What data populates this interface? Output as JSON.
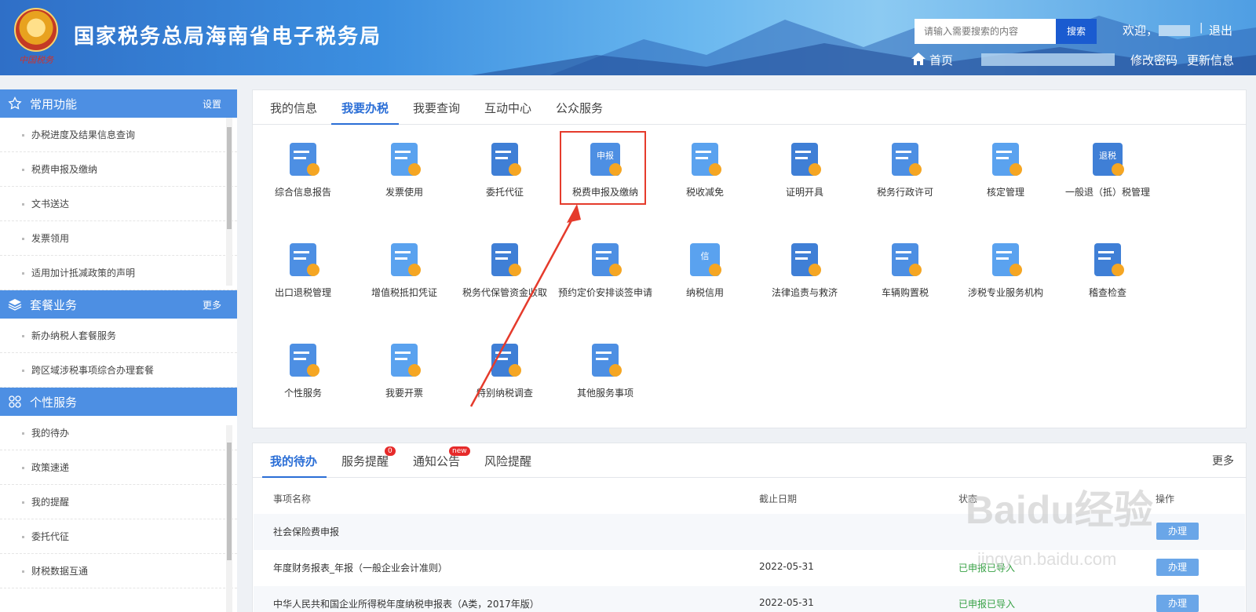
{
  "header": {
    "site_title": "国家税务总局海南省电子税务局",
    "emblem_text": "中国税务",
    "search_placeholder": "请输入需要搜索的内容",
    "search_label": "搜索",
    "welcome": "欢迎，",
    "logout": "退出",
    "home": "首页",
    "change_password": "修改密码",
    "update_info": "更新信息"
  },
  "sidebar": {
    "sections": [
      {
        "title": "常用功能",
        "action": "设置",
        "items": [
          "办税进度及结果信息查询",
          "税费申报及缴纳",
          "文书送达",
          "发票领用",
          "适用加计抵减政策的声明"
        ]
      },
      {
        "title": "套餐业务",
        "action": "更多",
        "items": [
          "新办纳税人套餐服务",
          "跨区域涉税事项综合办理套餐"
        ]
      },
      {
        "title": "个性服务",
        "action": "",
        "items": [
          "我的待办",
          "政策速递",
          "我的提醒",
          "委托代征",
          "财税数据互通"
        ]
      }
    ]
  },
  "main": {
    "tabs": [
      "我的信息",
      "我要办税",
      "我要查询",
      "互动中心",
      "公众服务"
    ],
    "active_tab": "我要办税",
    "services": [
      {
        "label": "综合信息报告",
        "icon": "report-icon"
      },
      {
        "label": "发票使用",
        "icon": "printer-icon"
      },
      {
        "label": "委托代征",
        "icon": "wallet-icon"
      },
      {
        "label": "税费申报及缴纳",
        "icon": "declaration-icon",
        "icon_text": "申报"
      },
      {
        "label": "税收减免",
        "icon": "tax-reduction-icon"
      },
      {
        "label": "证明开具",
        "icon": "certificate-icon"
      },
      {
        "label": "税务行政许可",
        "icon": "binders-icon"
      },
      {
        "label": "核定管理",
        "icon": "clipboard-pen-icon"
      },
      {
        "label": "一般退（抵）税管理",
        "icon": "refund-icon",
        "icon_text": "退税"
      },
      {
        "label": "出口退税管理",
        "icon": "ship-icon"
      },
      {
        "label": "增值税抵扣凭证",
        "icon": "yen-voucher-icon"
      },
      {
        "label": "税务代保管资金收取",
        "icon": "hand-coin-icon"
      },
      {
        "label": "预约定价安排谈签申请",
        "icon": "calendar-clock-icon"
      },
      {
        "label": "纳税信用",
        "icon": "credit-shield-icon",
        "icon_text": "信"
      },
      {
        "label": "法律追责与救济",
        "icon": "legal-person-icon"
      },
      {
        "label": "车辆购置税",
        "icon": "vehicle-clipboard-icon"
      },
      {
        "label": "涉税专业服务机构",
        "icon": "heart-hand-icon"
      },
      {
        "label": "稽查检查",
        "icon": "monitor-chart-icon"
      },
      {
        "label": "个性服务",
        "icon": "personal-service-icon"
      },
      {
        "label": "我要开票",
        "icon": "invoice-screen-icon"
      },
      {
        "label": "特别纳税调查",
        "icon": "search-doc-icon"
      },
      {
        "label": "其他服务事项",
        "icon": "layers-doc-icon"
      }
    ]
  },
  "todo": {
    "tabs": [
      "我的待办",
      "服务提醒",
      "通知公告",
      "风险提醒"
    ],
    "service_badge": "0",
    "notice_badge": "new",
    "more": "更多",
    "columns": [
      "事项名称",
      "截止日期",
      "状态",
      "操作"
    ],
    "rows": [
      {
        "name": "社会保险费申报",
        "date": "",
        "status": "",
        "op": "办理"
      },
      {
        "name": "年度财务报表_年报（一般企业会计准则）",
        "date": "2022-05-31",
        "status": "已申报已导入",
        "op": "办理"
      },
      {
        "name": "中华人民共和国企业所得税年度纳税申报表（A类，2017年版）",
        "date": "2022-05-31",
        "status": "已申报已导入",
        "op": "办理"
      }
    ]
  },
  "watermark": {
    "brand": "Baidu经验",
    "url": "jingyan.baidu.com"
  },
  "colors": {
    "primary": "#2a6ed6",
    "sidebar_head": "#4d8fe3",
    "highlight": "#e53b2c",
    "status_done": "#37a145"
  }
}
